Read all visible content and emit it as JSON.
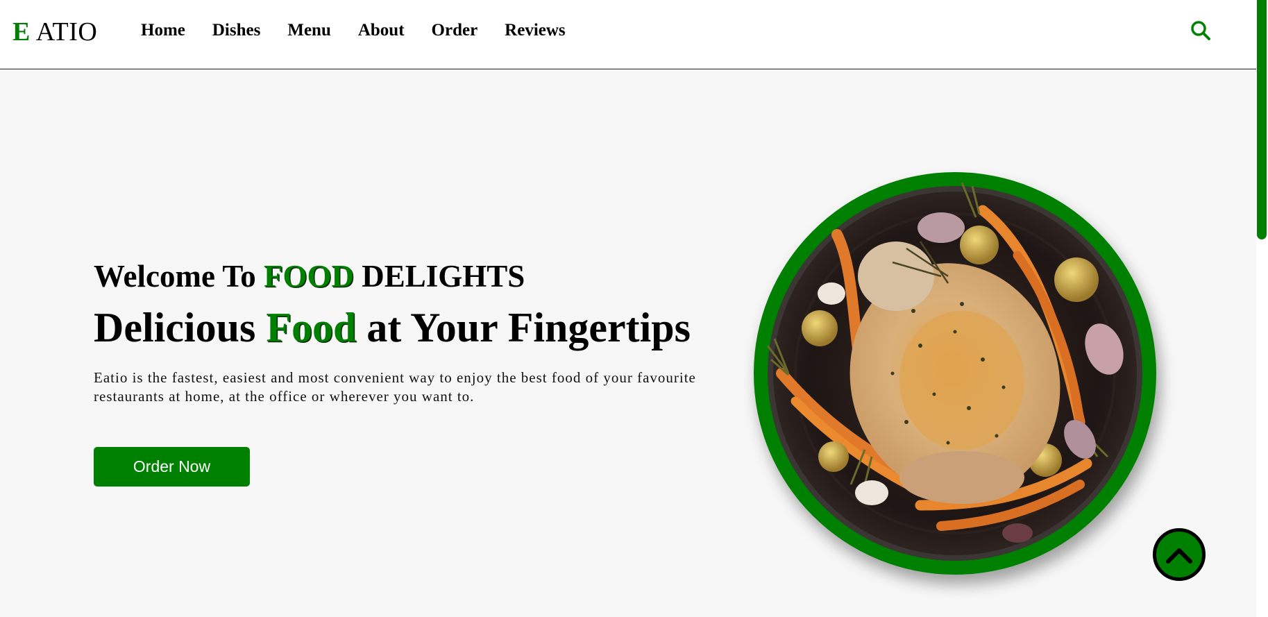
{
  "header": {
    "logo_accent": "E",
    "logo_rest": "ATIO",
    "nav": [
      "Home",
      "Dishes",
      "Menu",
      "About",
      "Order",
      "Reviews"
    ],
    "search_icon": "search-icon"
  },
  "hero": {
    "welcome_prefix": "Welcome To ",
    "welcome_highlight": "FOOD",
    "welcome_suffix": " DELIGHTS",
    "tagline_prefix": "Delicious ",
    "tagline_highlight": "Food",
    "tagline_suffix": " at Your Fingertips",
    "description": "Eatio is the fastest, easiest and most convenient way to enjoy the best food of your favourite restaurants at home, at the office or wherever you want to.",
    "order_button": "Order Now"
  },
  "image": {
    "subject": "roast-chicken-with-carrots-image"
  },
  "back_to_top_icon": "chevron-up-icon",
  "colors": {
    "accent": "#008000",
    "background": "#f7f7f7",
    "header_background": "#ffffff",
    "text": "#000000"
  }
}
